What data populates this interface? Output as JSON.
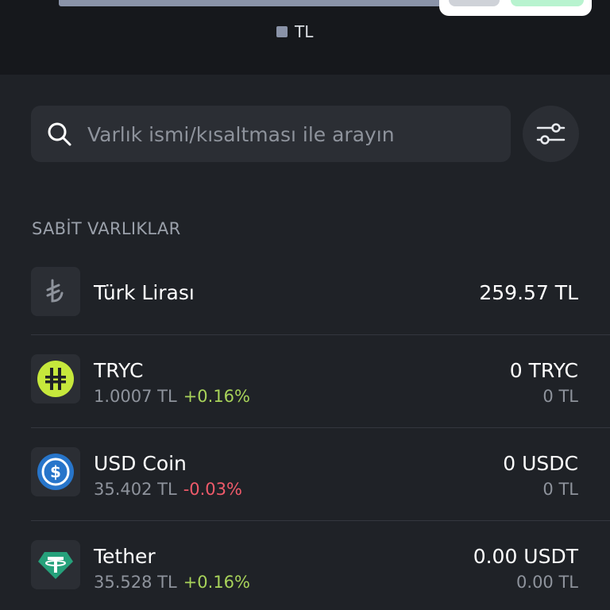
{
  "chart_legend": {
    "label": "TL",
    "color": "#8a93a8"
  },
  "search": {
    "placeholder": "Varlık ismi/kısaltması ile arayın"
  },
  "section": {
    "title": "SABİT VARLIKLAR"
  },
  "colors": {
    "positive": "#a8d35a",
    "negative": "#f05a6a",
    "background": "#1f2227"
  },
  "assets": [
    {
      "name": "Türk Lirası",
      "icon": "lira-icon",
      "amount": "259.57 TL"
    },
    {
      "name": "TRYC",
      "icon": "tryc-icon",
      "price": "1.0007 TL",
      "change": "+0.16%",
      "direction": "up",
      "amount": "0 TRYC",
      "amount_tl": "0 TL"
    },
    {
      "name": "USD Coin",
      "icon": "usdc-icon",
      "price": "35.402 TL",
      "change": "-0.03%",
      "direction": "down",
      "amount": "0 USDC",
      "amount_tl": "0 TL"
    },
    {
      "name": "Tether",
      "icon": "tether-icon",
      "price": "35.528 TL",
      "change": "+0.16%",
      "direction": "up",
      "amount": "0.00 USDT",
      "amount_tl": "0.00 TL"
    }
  ]
}
